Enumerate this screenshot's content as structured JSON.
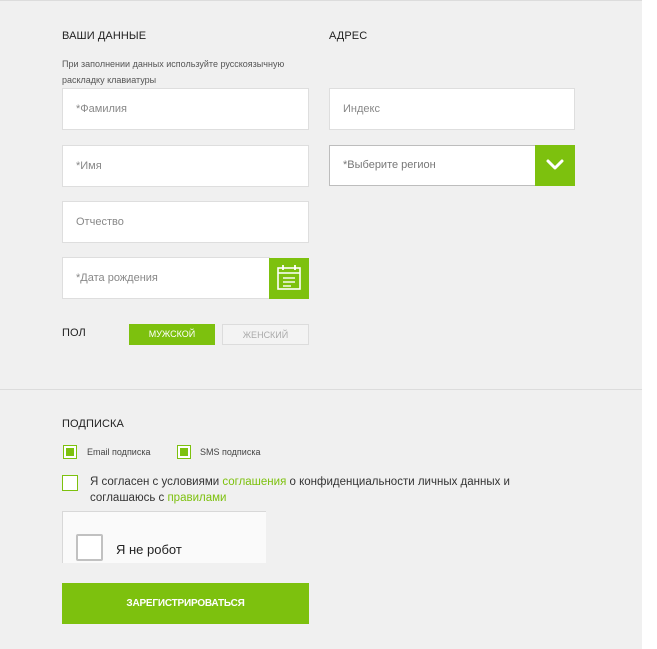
{
  "personal": {
    "title": "ВАШИ ДАННЫЕ",
    "hint": "При заполнении данных используйте русскоязычную раскладку клавиатуры",
    "last_name_placeholder": "*Фамилия",
    "first_name_placeholder": "*Имя",
    "patronymic_placeholder": "Отчество",
    "birthdate_placeholder": "*Дата рождения",
    "gender_label": "ПОЛ",
    "gender_male": "МУЖСКОЙ",
    "gender_female": "ЖЕНСКИЙ",
    "gender_selected": "МУЖСКОЙ"
  },
  "address": {
    "title": "АДРЕС",
    "index_placeholder": "Индекс",
    "region_placeholder": "*Выберите регион"
  },
  "subscription": {
    "title": "ПОДПИСКА",
    "email_label": "Email подписка",
    "email_checked": true,
    "sms_label": "SMS подписка",
    "sms_checked": true,
    "agree_checked": false,
    "agree_part1": "Я согласен с условиями ",
    "agree_link1": "соглашения",
    "agree_part2": " о конфиденциальности личных данных и соглашаюсь с ",
    "agree_link2": "правилами"
  },
  "captcha": {
    "label": "Я не робот"
  },
  "submit_label": "ЗАРЕГИСТРИРОВАТЬСЯ",
  "colors": {
    "accent": "#7dc10e",
    "background": "#f0f0f0"
  }
}
